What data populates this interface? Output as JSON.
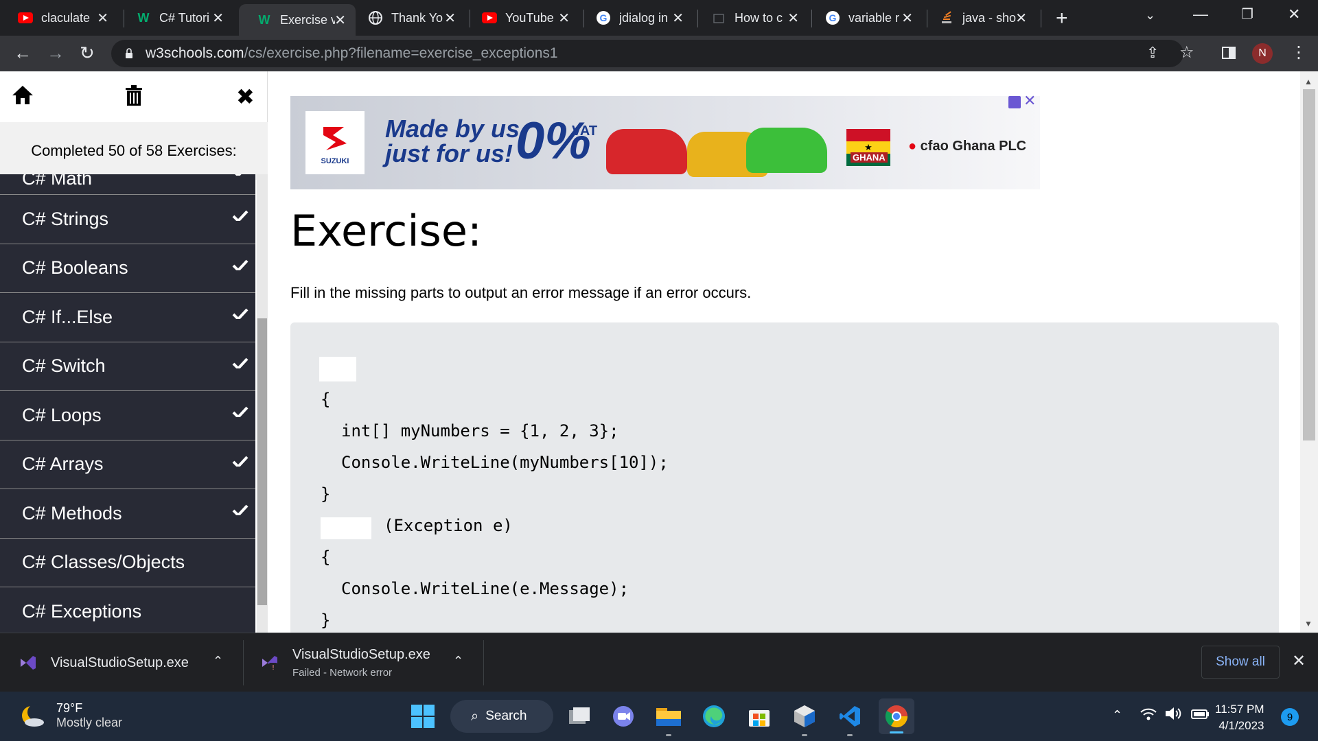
{
  "browser": {
    "tabs": [
      {
        "title": "claculate",
        "icon": "youtube-icon",
        "active": false
      },
      {
        "title": "C# Tutori",
        "icon": "w3schools-icon",
        "active": false
      },
      {
        "title": "Exercise v",
        "icon": "w3schools-icon",
        "active": true
      },
      {
        "title": "Thank Yo",
        "icon": "globe-icon",
        "active": false
      },
      {
        "title": "YouTube",
        "icon": "youtube-icon",
        "active": false
      },
      {
        "title": "jdialog in",
        "icon": "google-icon",
        "active": false
      },
      {
        "title": "How to c",
        "icon": "page-icon",
        "active": false
      },
      {
        "title": "variable r",
        "icon": "google-icon",
        "active": false
      },
      {
        "title": "java - sho",
        "icon": "stackoverflow-icon",
        "active": false
      }
    ],
    "url_host": "w3schools.com",
    "url_path": "/cs/exercise.php?filename=exercise_exceptions1",
    "profile_initial": "N"
  },
  "sidebar": {
    "progress_text": "Completed 50 of 58 Exercises:",
    "items": [
      {
        "label": "C# Math",
        "done": true
      },
      {
        "label": "C# Strings",
        "done": true
      },
      {
        "label": "C# Booleans",
        "done": true
      },
      {
        "label": "C# If...Else",
        "done": true
      },
      {
        "label": "C# Switch",
        "done": true
      },
      {
        "label": "C# Loops",
        "done": true
      },
      {
        "label": "C# Arrays",
        "done": true
      },
      {
        "label": "C# Methods",
        "done": true
      },
      {
        "label": "C# Classes/Objects",
        "done": false
      },
      {
        "label": "C# Exceptions",
        "done": false
      }
    ]
  },
  "ad": {
    "brand": "SUZUKI",
    "headline_1": "Made by us,",
    "headline_2": "just for us!",
    "percent": "0%",
    "vat": "VAT",
    "flag_text": "GHANA",
    "partner": "cfao Ghana PLC"
  },
  "exercise": {
    "title": "Exercise:",
    "description": "Fill in the missing parts to output an error message if an error occurs.",
    "code": {
      "line_open1": "{",
      "line_numbers": "int[] myNumbers = {1, 2, 3};",
      "line_write1": "Console.WriteLine(myNumbers[10]);",
      "line_close1": "}",
      "line_catch_rest": "(Exception e)",
      "line_open2": "{",
      "line_write2": "Console.WriteLine(e.Message);",
      "line_close2": "}"
    }
  },
  "downloads": {
    "items": [
      {
        "name": "VisualStudioSetup.exe",
        "status": ""
      },
      {
        "name": "VisualStudioSetup.exe",
        "status": "Failed - Network error"
      }
    ],
    "show_all": "Show all"
  },
  "taskbar": {
    "temperature": "79°F",
    "condition": "Mostly clear",
    "search_label": "Search",
    "time": "11:57 PM",
    "date": "4/1/2023",
    "notifications": "9"
  }
}
